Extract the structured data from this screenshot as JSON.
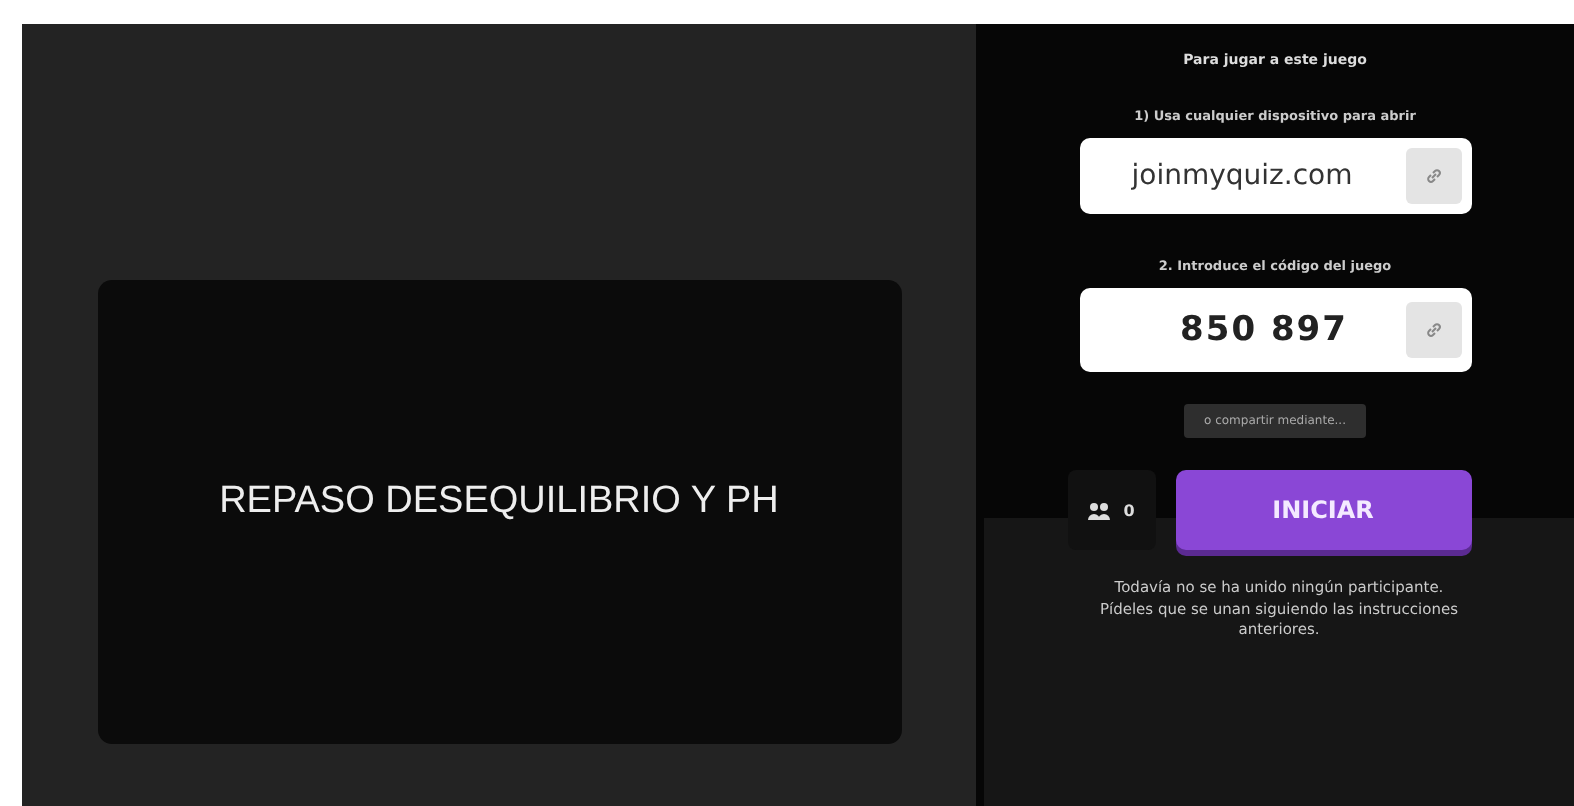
{
  "quiz": {
    "title": "REPASO DESEQUILIBRIO Y PH"
  },
  "join": {
    "heading": "Para jugar a este juego",
    "step_1": "1) Usa cualquier dispositivo para abrir",
    "url": "joinmyquiz.com",
    "step_2": "2. Introduce el código del juego",
    "code": "850 897",
    "share_button": "o compartir mediante..."
  },
  "players": {
    "count": "0"
  },
  "start_button": "INICIAR",
  "empty_message": "Todavía no se ha unido ningún participante. Pídeles que se unan siguiendo las instrucciones anteriores."
}
